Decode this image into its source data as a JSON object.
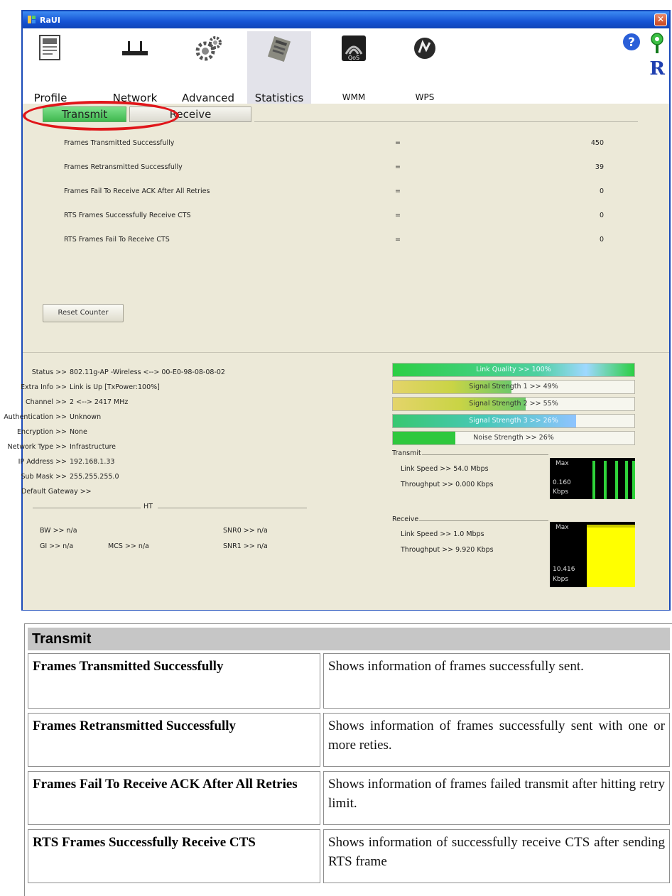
{
  "window": {
    "title": "RaUI",
    "close_glyph": "✕"
  },
  "toolbar": {
    "items": [
      {
        "label": "Profile",
        "icon": "profile-icon"
      },
      {
        "label": "Network",
        "icon": "network-icon"
      },
      {
        "label": "Advanced",
        "icon": "advanced-icon"
      },
      {
        "label": "Statistics",
        "icon": "statistics-icon",
        "active": true
      },
      {
        "label": "WMM",
        "icon": "wmm-icon"
      },
      {
        "label": "WPS",
        "icon": "wps-icon"
      }
    ],
    "wmm_badge": "QoS",
    "logo": "R"
  },
  "tabs": {
    "transmit": "Transmit",
    "receive": "Receive"
  },
  "stats": [
    {
      "label": "Frames Transmitted Successfully",
      "sep": "=",
      "value": "450"
    },
    {
      "label": "Frames Retransmitted Successfully",
      "sep": "=",
      "value": "39"
    },
    {
      "label": "Frames Fail To Receive ACK After All Retries",
      "sep": "=",
      "value": "0"
    },
    {
      "label": "RTS Frames Successfully Receive CTS",
      "sep": "=",
      "value": "0"
    },
    {
      "label": "RTS Frames Fail To Receive CTS",
      "sep": "=",
      "value": "0"
    }
  ],
  "reset_button": "Reset Counter",
  "status": {
    "rows": [
      {
        "key": "Status >>",
        "value": "802.11g-AP -Wireless <--> 00-E0-98-08-08-02"
      },
      {
        "key": "Extra Info >>",
        "value": "Link is Up [TxPower:100%]"
      },
      {
        "key": "Channel >>",
        "value": "2 <--> 2417 MHz"
      },
      {
        "key": "Authentication >>",
        "value": "Unknown"
      },
      {
        "key": "Encryption >>",
        "value": "None"
      },
      {
        "key": "Network Type >>",
        "value": "Infrastructure"
      },
      {
        "key": "IP Address >>",
        "value": "192.168.1.33"
      },
      {
        "key": "Sub Mask >>",
        "value": "255.255.255.0"
      },
      {
        "key": "Default Gateway >>",
        "value": ""
      }
    ],
    "ht_label": "HT",
    "ht": {
      "bw": "BW >> n/a",
      "gi": "GI >> n/a",
      "mcs": "MCS >> n/a",
      "snr0": "SNR0 >> n/a",
      "snr1": "SNR1 >> n/a"
    }
  },
  "signal": {
    "link_quality": {
      "text": "Link Quality >> 100%",
      "level": 100
    },
    "signal1": {
      "text": "Signal Strength 1 >> 49%",
      "level": 49
    },
    "signal2": {
      "text": "Signal Strength 2 >> 55%",
      "level": 55
    },
    "signal3": {
      "text": "Signal Strength 3 >> 26%",
      "level": 26
    },
    "noise": {
      "text": "Noise Strength >> 26%",
      "level": 26
    }
  },
  "transmit": {
    "title": "Transmit",
    "link_speed": "Link Speed >> 54.0 Mbps",
    "throughput": "Throughput >> 0.000 Kbps",
    "graph_max": "Max",
    "graph_value": "0.160",
    "graph_unit": "Kbps"
  },
  "receive": {
    "title": "Receive",
    "link_speed": "Link Speed >> 1.0 Mbps",
    "throughput": "Throughput >> 9.920 Kbps",
    "graph_max": "Max",
    "graph_value": "10.416",
    "graph_unit": "Kbps"
  },
  "colors": {
    "accent_green": "#3fb84f",
    "highlight_red": "#e0161a",
    "graph_yellow": "#ffff00",
    "graph_green": "#2fd33a"
  },
  "description_table": {
    "header": "Transmit",
    "rows": [
      {
        "term": "Frames Transmitted Successfully",
        "definition": "Shows information of frames successfully sent."
      },
      {
        "term": "Frames Retransmitted Successfully",
        "definition": "Shows information of frames successfully sent with one or more reties."
      },
      {
        "term": "Frames Fail To Receive ACK After All Retries",
        "definition": "Shows information of frames failed transmit after hitting retry limit."
      },
      {
        "term": "RTS Frames Successfully Receive CTS",
        "definition": "Shows information of successfully receive CTS after sending RTS frame"
      }
    ]
  }
}
